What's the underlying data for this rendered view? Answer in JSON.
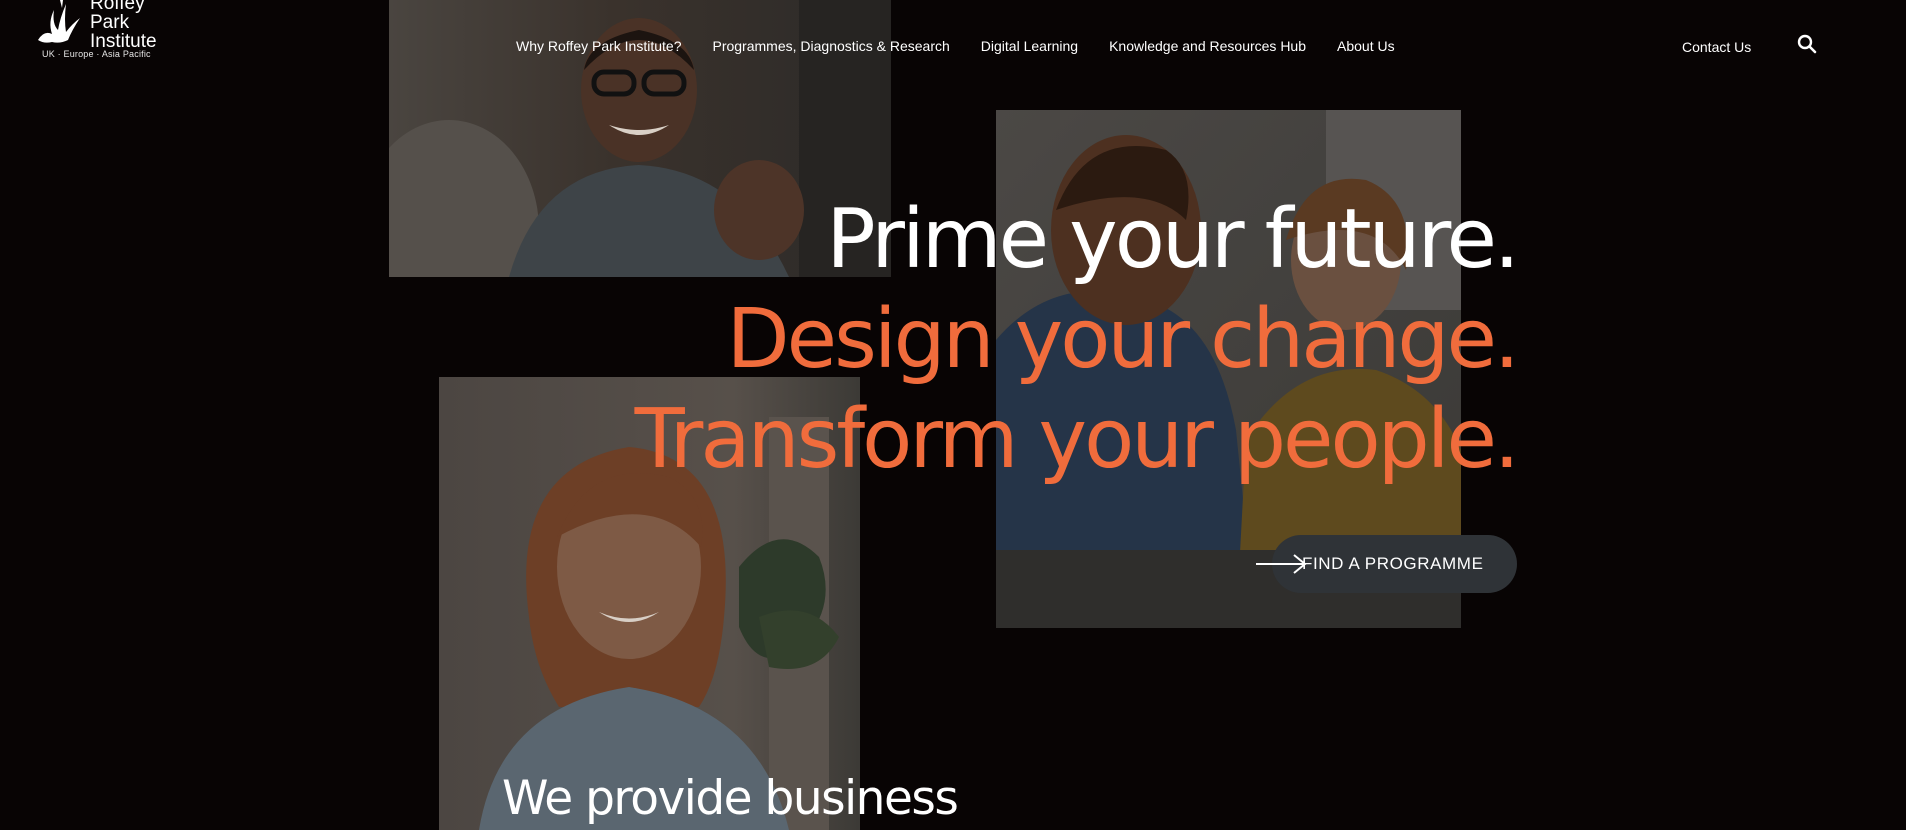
{
  "brand": {
    "name_lines": [
      "Roffey",
      "Park",
      "Institute"
    ],
    "tagline": "UK · Europe · Asia Pacific"
  },
  "nav": {
    "items": [
      {
        "label": "Why Roffey Park Institute?"
      },
      {
        "label": "Programmes, Diagnostics & Research"
      },
      {
        "label": "Digital Learning"
      },
      {
        "label": "Knowledge and Resources Hub"
      },
      {
        "label": "About Us"
      }
    ],
    "contact_label": "Contact Us",
    "search_icon": "search-icon"
  },
  "hero": {
    "line1": "Prime your future.",
    "line2": "Design your change.",
    "line3": "Transform your people.",
    "cta_label": "FIND A PROGRAMME",
    "cta_icon": "arrow-right-icon"
  },
  "intro": {
    "heading": "We provide business"
  },
  "colors": {
    "background": "#080404",
    "accent": "#f06c3c",
    "cta_background": "#2f3337",
    "text": "#ffffff"
  }
}
